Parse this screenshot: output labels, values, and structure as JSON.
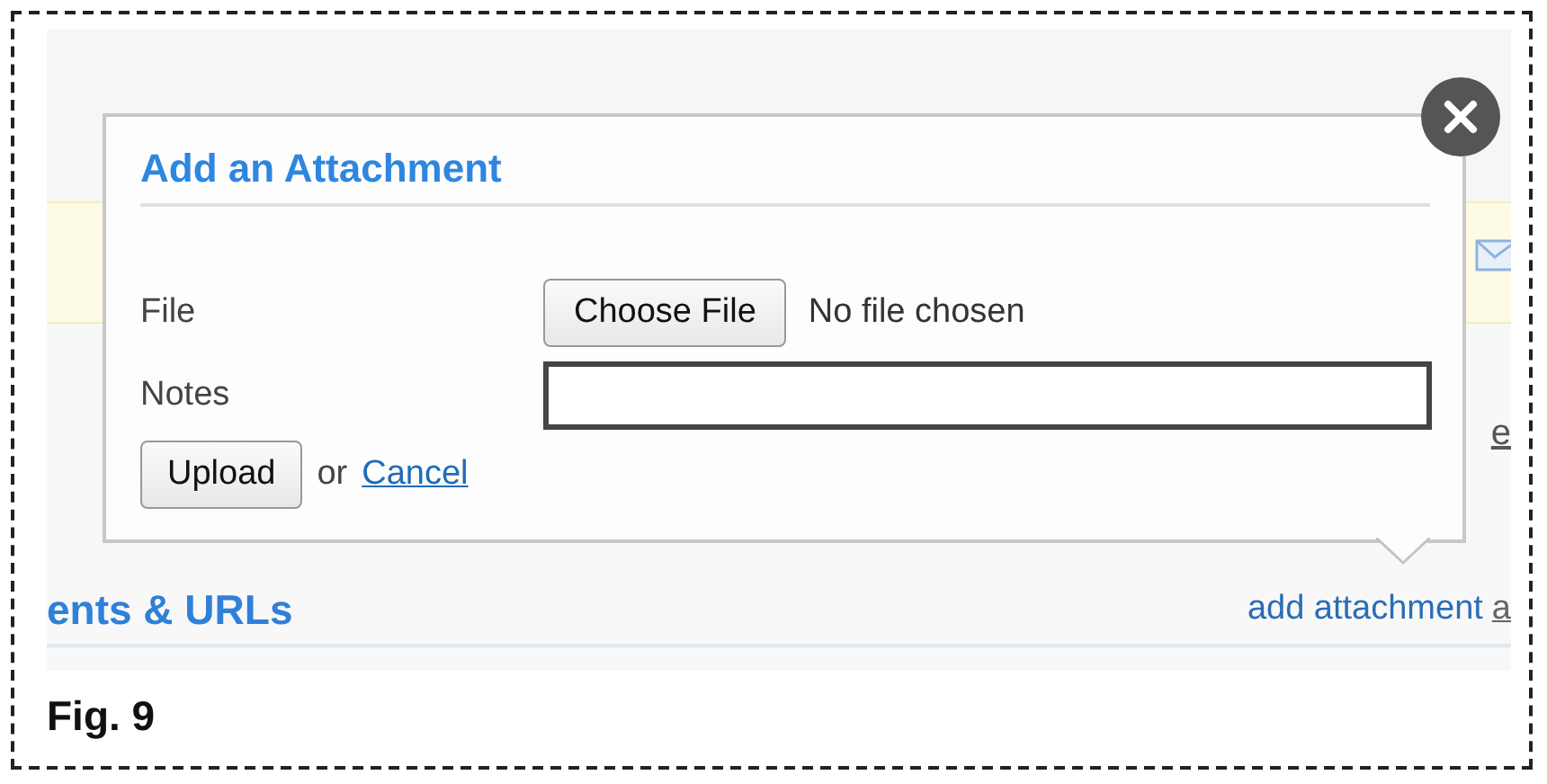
{
  "background": {
    "side_link": "e",
    "section_title": "ents & URLs",
    "links": [
      {
        "label": "add attachment",
        "underlined": false
      },
      {
        "label": "a",
        "underlined": true
      }
    ]
  },
  "dialog": {
    "title": "Add an Attachment",
    "file_label": "File",
    "choose_button": "Choose File",
    "file_status": "No file chosen",
    "notes_label": "Notes",
    "upload_button": "Upload",
    "or_text": "or",
    "cancel_link": "Cancel"
  },
  "caption": "Fig. 9"
}
